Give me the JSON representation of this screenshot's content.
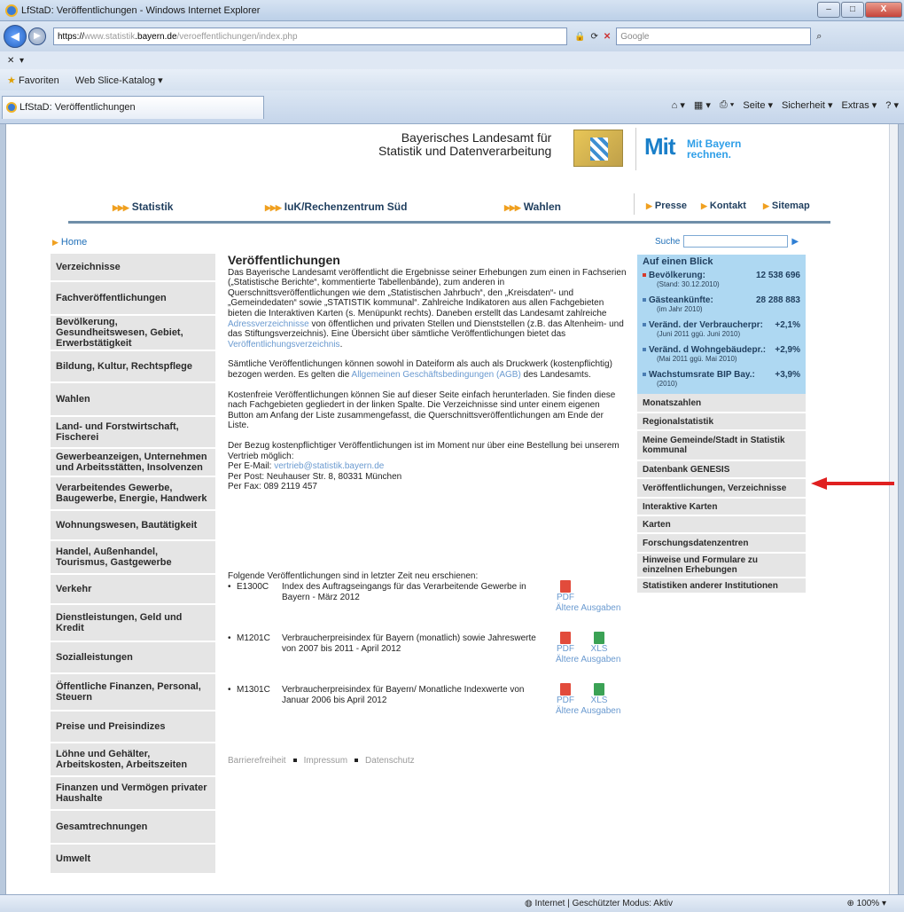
{
  "window": {
    "title": "LfStaD: Veröffentlichungen - Windows Internet Explorer",
    "controls": [
      "–",
      "□",
      "X"
    ]
  },
  "address": {
    "url_scheme": "https://",
    "url_host_blur": "www.statistik",
    "url_host": ".bayern.de",
    "url_path": "/veroeffentlichungen/index.php",
    "search_engine": "Google"
  },
  "favorites": {
    "label": "Favoriten",
    "web_slice": "Web Slice-Katalog ▾"
  },
  "tab": {
    "title": "LfStaD: Veröffentlichungen"
  },
  "tools": [
    "Seite ▾",
    "Sicherheit ▾",
    "Extras ▾"
  ],
  "header": {
    "line1": "Bayerisches Landesamt für",
    "line2": "Statistik und Datenverarbeitung",
    "mit": "Mit",
    "mit_small1": "Mit Bayern",
    "mit_small2": "rechnen."
  },
  "nav": {
    "statistik": "Statistik",
    "iuk": "IuK/Rechenzentrum Süd",
    "wahlen": "Wahlen",
    "presse": "Presse",
    "kontakt": "Kontakt",
    "sitemap": "Sitemap"
  },
  "home": "Home",
  "left_nav": [
    {
      "label": "Verzeichnisse"
    },
    {
      "label": "Fachveröffentlichungen"
    },
    {
      "label": "Bevölkerung, Gesundheitswesen, Gebiet, Erwerbstätigkeit"
    },
    {
      "label": "Bildung, Kultur, Rechtspflege"
    },
    {
      "label": "Wahlen"
    },
    {
      "label": "Land- und Forstwirtschaft, Fischerei"
    },
    {
      "label": "Gewerbeanzeigen, Unternehmen und Arbeitsstätten, Insolvenzen"
    },
    {
      "label": "Verarbeitendes Gewerbe, Baugewerbe, Energie, Handwerk"
    },
    {
      "label": "Wohnungswesen, Bautätigkeit"
    },
    {
      "label": "Handel, Außenhandel, Tourismus, Gastgewerbe"
    },
    {
      "label": "Verkehr"
    },
    {
      "label": "Dienstleistungen, Geld und Kredit"
    },
    {
      "label": "Sozialleistungen"
    },
    {
      "label": "Öffentliche Finanzen, Personal, Steuern"
    },
    {
      "label": "Preise und Preisindizes"
    },
    {
      "label": "Löhne und Gehälter, Arbeitskosten, Arbeitszeiten"
    },
    {
      "label": "Finanzen und Vermögen privater Haushalte"
    },
    {
      "label": "Gesamtrechnungen"
    },
    {
      "label": "Umwelt"
    }
  ],
  "content": {
    "title": "Veröffentlichungen",
    "p1a": "Das Bayerische Landesamt veröffentlicht die Ergebnisse seiner Erhebungen zum einen in Fachserien („Statistische Berichte“, kommentierte Tabellenbände), zum anderen in Querschnittsveröffentlichungen wie dem „Statistischen Jahrbuch“, den „Kreisdaten“- und „Gemeindedaten“ sowie „STATISTIK kommunal“. Zahlreiche Indikatoren aus allen Fachgebieten bieten die Interaktiven Karten (s. Menüpunkt rechts). Daneben erstellt das Landesamt zahlreiche ",
    "p1_link1": "Adressverzeichnisse",
    "p1b": " von öffentlichen und privaten Stellen und Dienststellen (z.B. das Altenheim- und das Stiftungsverzeichnis). Eine Übersicht über sämtliche Veröffentlichungen bietet das ",
    "p1_link2": "Veröffentlichungsverzeichnis",
    "p1c": ".",
    "p2a": "Sämtliche Veröffentlichungen können sowohl in Dateiform als auch als Druckwerk (kostenpflichtig) bezogen werden. Es gelten die ",
    "p2_link": "Allgemeinen Geschäftsbedingungen (AGB)",
    "p2b": " des Landesamts.",
    "p3": "Kostenfreie Veröffentlichungen können Sie auf dieser Seite einfach herunterladen. Sie finden diese nach Fachgebieten gegliedert in der linken Spalte. Die Verzeichnisse sind unter einem eigenen Button am Anfang der Liste zusammengefasst, die Querschnittsveröffentlichungen am Ende der Liste.",
    "p4a": "Der Bezug kostenpflichtiger Veröffentlichungen ist im Moment nur über eine Bestellung bei unserem Vertrieb möglich:",
    "p4_email_label": "Per E-Mail: ",
    "p4_email": "vertrieb@statistik.bayern.de",
    "p4_post": "Per Post: Neuhauser Str. 8, 80331 München",
    "p4_fax": "Per Fax: 089 2119 457",
    "recent_intro": "Folgende Veröffentlichungen sind in letzter Zeit neu erschienen:",
    "pubs": [
      {
        "code": "E1300C",
        "desc": "Index des Auftragseingangs für das Verarbeitende Gewerbe in Bayern - März 2012",
        "pdf": "PDF",
        "older": "Ältere Ausgaben"
      },
      {
        "code": "M1201C",
        "desc": "Verbraucherpreisindex für Bayern (monatlich) sowie Jahreswerte von 2007 bis 2011 - April 2012",
        "pdf": "PDF",
        "xls": "XLS",
        "older": "Ältere Ausgaben"
      },
      {
        "code": "M1301C",
        "desc": "Verbraucherpreisindex für Bayern/ Monatliche Indexwerte von Januar 2006 bis April 2012",
        "pdf": "PDF",
        "xls": "XLS",
        "older": "Ältere Ausgaben"
      }
    ],
    "bullet": "•"
  },
  "footer": {
    "barrier": "Barrierefreiheit",
    "impressum": "Impressum",
    "datenschutz": "Datenschutz"
  },
  "search": {
    "label": "Suche"
  },
  "glance": {
    "title": "Auf einen Blick",
    "items": [
      {
        "label": "Bevölkerung:",
        "value": "12 538 696",
        "sub": "(Stand: 30.12.2010)"
      },
      {
        "label": "Gästeankünfte:",
        "value": "28 288 883",
        "sub": "(im Jahr 2010)"
      },
      {
        "label": "Veränd. der Verbraucherpr:",
        "value": "+2,1%",
        "sub": "(Juni 2011 ggü. Juni 2010)"
      },
      {
        "label": "Veränd. d Wohngebäudepr.:",
        "value": "+2,9%",
        "sub": "(Mai 2011 ggü. Mai 2010)"
      },
      {
        "label": "Wachstumsrate BIP Bay.:",
        "value": "+3,9%",
        "sub": "(2010)"
      }
    ]
  },
  "right_nav": [
    {
      "label": "Monatszahlen"
    },
    {
      "label": "Regionalstatistik"
    },
    {
      "label": "Meine Gemeinde/Stadt in Statistik kommunal"
    },
    {
      "label": "Datenbank GENESIS"
    },
    {
      "label": "Veröffentlichungen, Verzeichnisse"
    },
    {
      "label": "Interaktive Karten"
    },
    {
      "label": "Karten"
    },
    {
      "label": "Forschungsdatenzentren"
    },
    {
      "label": "Hinweise und Formulare zu einzelnen Erhebungen"
    },
    {
      "label": "Statistiken anderer Institutionen"
    }
  ],
  "statusbar": {
    "zone": "Internet | Geschützter Modus: Aktiv",
    "zoom": "100%"
  },
  "colors": {
    "accent": "#1f6fb8",
    "glance_bg": "#aed8f2",
    "arrow": "#e02020",
    "nav_arrow": "#f0a020"
  }
}
